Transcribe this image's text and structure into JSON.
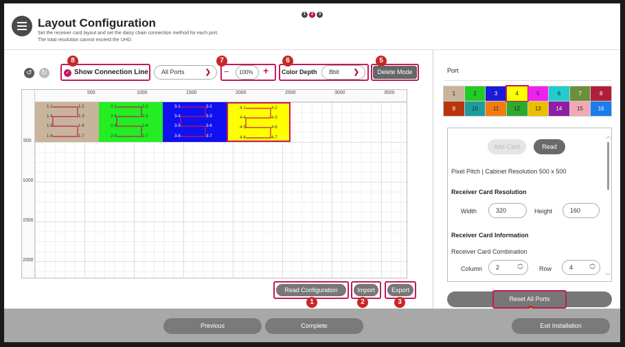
{
  "header": {
    "title": "Layout Configuration",
    "subtitle1": "Set the receiver card layout and set the daisy chain connection method for each port.",
    "subtitle2": "The total resolution cannot exceed the UHD.",
    "steps": [
      "1",
      "2",
      "3"
    ]
  },
  "toolbar": {
    "undo_icon": "undo-icon",
    "redo_icon": "redo-icon",
    "show_connection_line": "Show Connection Line",
    "ports_select": "All Ports",
    "zoom": "100%",
    "zoom_minus": "−",
    "zoom_plus": "+",
    "color_depth_label": "Color Depth",
    "color_depth_value": "8bit",
    "delete_mode": "Delete Mode"
  },
  "ruler": {
    "x": [
      "500",
      "1000",
      "1500",
      "2000",
      "2500",
      "3000",
      "3500"
    ],
    "y": [
      "500",
      "1000",
      "1500",
      "2000"
    ]
  },
  "cards": [
    {
      "labels": [
        "1-1",
        "1-2",
        "1-4",
        "1-3",
        "1-5",
        "1-6",
        "1-8",
        "1-7"
      ]
    },
    {
      "labels": [
        "2-1",
        "2-2",
        "2-4",
        "2-3",
        "2-5",
        "2-6",
        "2-8",
        "2-7"
      ]
    },
    {
      "labels": [
        "3-1",
        "3-2",
        "3-4",
        "3-3",
        "3-5",
        "3-6",
        "3-8",
        "3-7"
      ]
    },
    {
      "labels": [
        "4-1",
        "4-2",
        "4-4",
        "4-3",
        "4-5",
        "4-6",
        "4-8",
        "4-7"
      ]
    }
  ],
  "actions": {
    "read_configuration": "Read Configuration",
    "import": "Import",
    "export": "Export"
  },
  "badges": [
    "1",
    "2",
    "3",
    "4",
    "5",
    "6",
    "7",
    "8"
  ],
  "port_panel": {
    "title": "Port",
    "ports": [
      {
        "n": "1",
        "color": "#c8b49a"
      },
      {
        "n": "2",
        "color": "#22cc22"
      },
      {
        "n": "3",
        "color": "#1a1adb"
      },
      {
        "n": "4",
        "color": "#ffff00"
      },
      {
        "n": "5",
        "color": "#ee22ee"
      },
      {
        "n": "6",
        "color": "#22cccc"
      },
      {
        "n": "7",
        "color": "#6b8f3a"
      },
      {
        "n": "8",
        "color": "#b01e3a"
      },
      {
        "n": "9",
        "color": "#b8360e"
      },
      {
        "n": "10",
        "color": "#1e9c9c"
      },
      {
        "n": "11",
        "color": "#f07c10"
      },
      {
        "n": "12",
        "color": "#2ea82e"
      },
      {
        "n": "13",
        "color": "#e8c000"
      },
      {
        "n": "14",
        "color": "#8e1ea6"
      },
      {
        "n": "15",
        "color": "#f3a8b5"
      },
      {
        "n": "16",
        "color": "#1a7de8"
      }
    ],
    "add_card": "Add Card",
    "read": "Read",
    "pixel_pitch": "Pixel Pitch | Cabinet Resolution 500 x 500",
    "rc_resolution": "Receiver Card Resolution",
    "width_label": "Width",
    "width": "320",
    "height_label": "Height",
    "height": "160",
    "rc_info": "Receiver Card Information",
    "rc_combination": "Receiver Card Combination",
    "column_label": "Column",
    "column": "2",
    "row_label": "Row",
    "row": "4",
    "reset_all_ports": "Reset All Ports"
  },
  "footer": {
    "previous": "Previous",
    "complete": "Complete",
    "exit": "Exit Installation"
  }
}
